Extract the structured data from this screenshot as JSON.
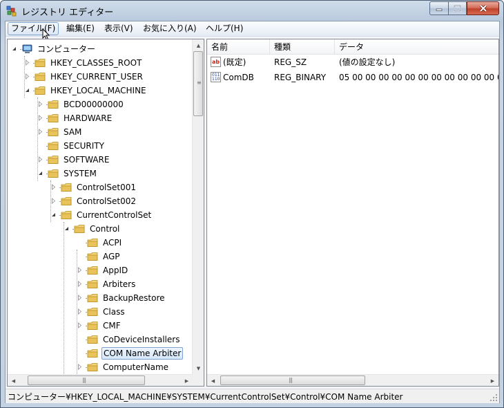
{
  "window": {
    "title": "レジストリ エディター"
  },
  "menu": {
    "file": "ファイル(F)",
    "edit": "編集(E)",
    "view": "表示(V)",
    "favorites": "お気に入り(A)",
    "help": "ヘルプ(H)"
  },
  "tree": {
    "root": "コンピューター",
    "hkcr": "HKEY_CLASSES_ROOT",
    "hkcu": "HKEY_CURRENT_USER",
    "hklm": "HKEY_LOCAL_MACHINE",
    "bcd": "BCD00000000",
    "hardware": "HARDWARE",
    "sam": "SAM",
    "security": "SECURITY",
    "software": "SOFTWARE",
    "system": "SYSTEM",
    "cs001": "ControlSet001",
    "cs002": "ControlSet002",
    "ccs": "CurrentControlSet",
    "control": "Control",
    "acpi": "ACPI",
    "agp": "AGP",
    "appid": "AppID",
    "arbiters": "Arbiters",
    "backup": "BackupRestore",
    "class": "Class",
    "cmf": "CMF",
    "codevice": "CoDeviceInstallers",
    "comname": "COM Name Arbiter",
    "computername": "ComputerName"
  },
  "list": {
    "headers": {
      "name": "名前",
      "type": "種類",
      "data": "データ"
    },
    "rows": [
      {
        "name": "(既定)",
        "type": "REG_SZ",
        "data": "(値の設定なし)",
        "icon": "string-value-icon"
      },
      {
        "name": "ComDB",
        "type": "REG_BINARY",
        "data": "05 00 00 00 00 00 00 00 00 00 00 00 00",
        "icon": "binary-value-icon"
      }
    ]
  },
  "status": {
    "path": "コンピューター¥HKEY_LOCAL_MACHINE¥SYSTEM¥CurrentControlSet¥Control¥COM Name Arbiter"
  },
  "colors": {
    "selection_border": "#7da2ce",
    "folder": "#e8c35a",
    "close_button": "#c1432c"
  }
}
